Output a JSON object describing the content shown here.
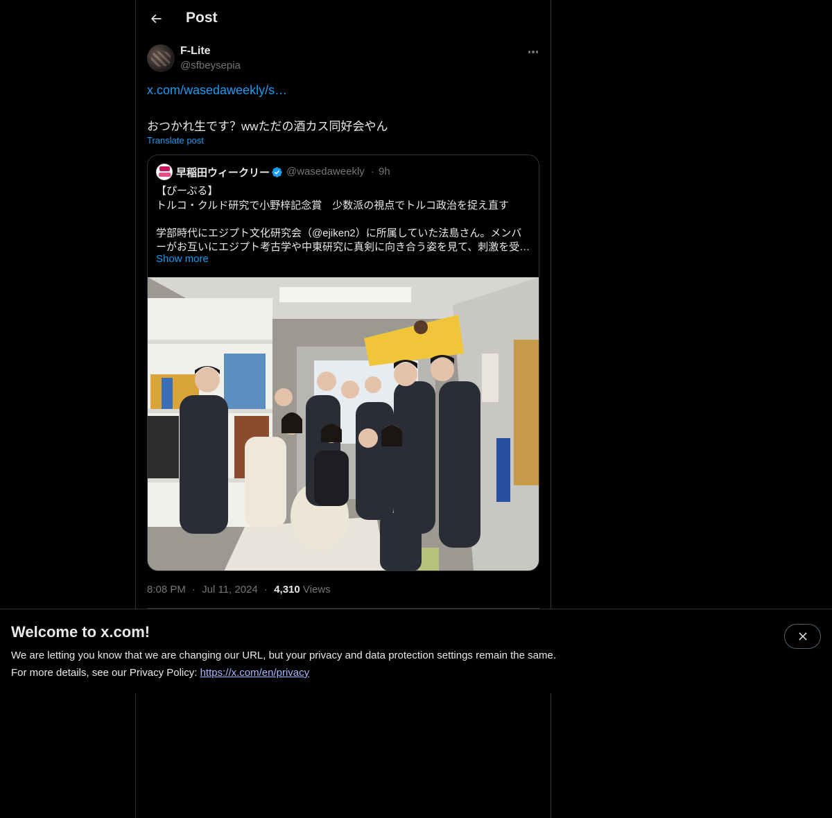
{
  "header": {
    "title": "Post",
    "back_icon": "arrow-left-icon"
  },
  "post": {
    "author_name": "F-Lite",
    "author_handle": "@sfbeysepia",
    "more_icon": "more-horizontal-icon",
    "link_text": "x.com/wasedaweekly/s…",
    "text": "おつかれ生です？wwただの酒カス同好会やん",
    "translate_label": "Translate post",
    "timestamp_time": "8:08 PM",
    "separator": "·",
    "timestamp_date": "Jul 11, 2024",
    "views_count": "4,310",
    "views_label": "Views"
  },
  "quote": {
    "avatar_icon": "wasedaweekly-logo",
    "name": "早稲田ウィークリー",
    "verified_icon": "verified-badge-icon",
    "handle": "@wasedaweekly",
    "separator": "·",
    "time": "9h",
    "lines": [
      "【ぴーぷる】",
      "トルコ・クルド研究で小野梓記念賞　少数派の視点でトルコ政治を捉え直す",
      "学部時代にエジプト文化研究会（@ejiken2）に所属していた法島さん。メンバ",
      "ーがお互いにエジプト考古学や中東研究に真剣に向き合う姿を見て、刺激を受…"
    ],
    "show_more": "Show more",
    "image_alt": "Group photo of students in a club room"
  },
  "banner": {
    "title": "Welcome to x.com!",
    "line1": "We are letting you know that we are changing our URL, but your privacy and data protection settings remain the same.",
    "line2_prefix": "For more details, see our Privacy Policy: ",
    "link_text": "https://x.com/en/privacy",
    "close_icon": "close-icon"
  },
  "colors": {
    "background": "#000000",
    "text": "#e7e9ea",
    "muted": "#71767b",
    "link": "#1d9bf0",
    "border": "#2f3336",
    "banner_link": "#a8b8ff"
  }
}
